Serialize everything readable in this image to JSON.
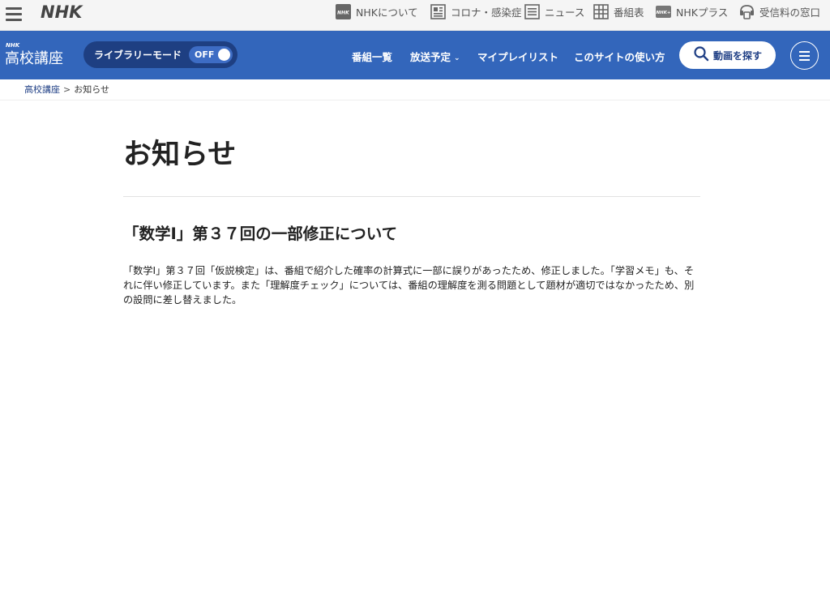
{
  "topbar": {
    "logo": "NHK",
    "links": [
      {
        "label": "NHKについて",
        "icon": "nhk-square-icon"
      },
      {
        "label": "コロナ・感染症",
        "icon": "newspaper-icon"
      },
      {
        "label": "ニュース",
        "icon": "news-list-icon"
      },
      {
        "label": "番組表",
        "icon": "grid-icon"
      },
      {
        "label": "NHKプラス",
        "icon": "nhk-plus-icon"
      },
      {
        "label": "受信料の窓口",
        "icon": "reception-icon"
      }
    ]
  },
  "header": {
    "logo_small": "NHK",
    "site_name": "高校講座",
    "library_mode_label": "ライブラリーモード",
    "library_mode_state": "OFF",
    "nav": [
      {
        "label": "番組一覧"
      },
      {
        "label": "放送予定",
        "has_dropdown": true
      },
      {
        "label": "マイプレイリスト"
      },
      {
        "label": "このサイトの使い方"
      }
    ],
    "search_button_label": "動画を探す",
    "accent_color": "#3366bb"
  },
  "breadcrumb": {
    "home": "高校講座",
    "separator": ">",
    "current": "お知らせ"
  },
  "main": {
    "page_title": "お知らせ",
    "article_title": "「数学Ⅰ」第３７回の一部修正について",
    "article_body": "「数学Ⅰ」第３７回「仮説検定」は、番組で紹介した確率の計算式に一部に誤りがあったため、修正しました。「学習メモ」も、それに伴い修正しています。また「理解度チェック」については、番組の理解度を測る問題として題材が適切ではなかったため、別の設問に差し替えました。"
  }
}
